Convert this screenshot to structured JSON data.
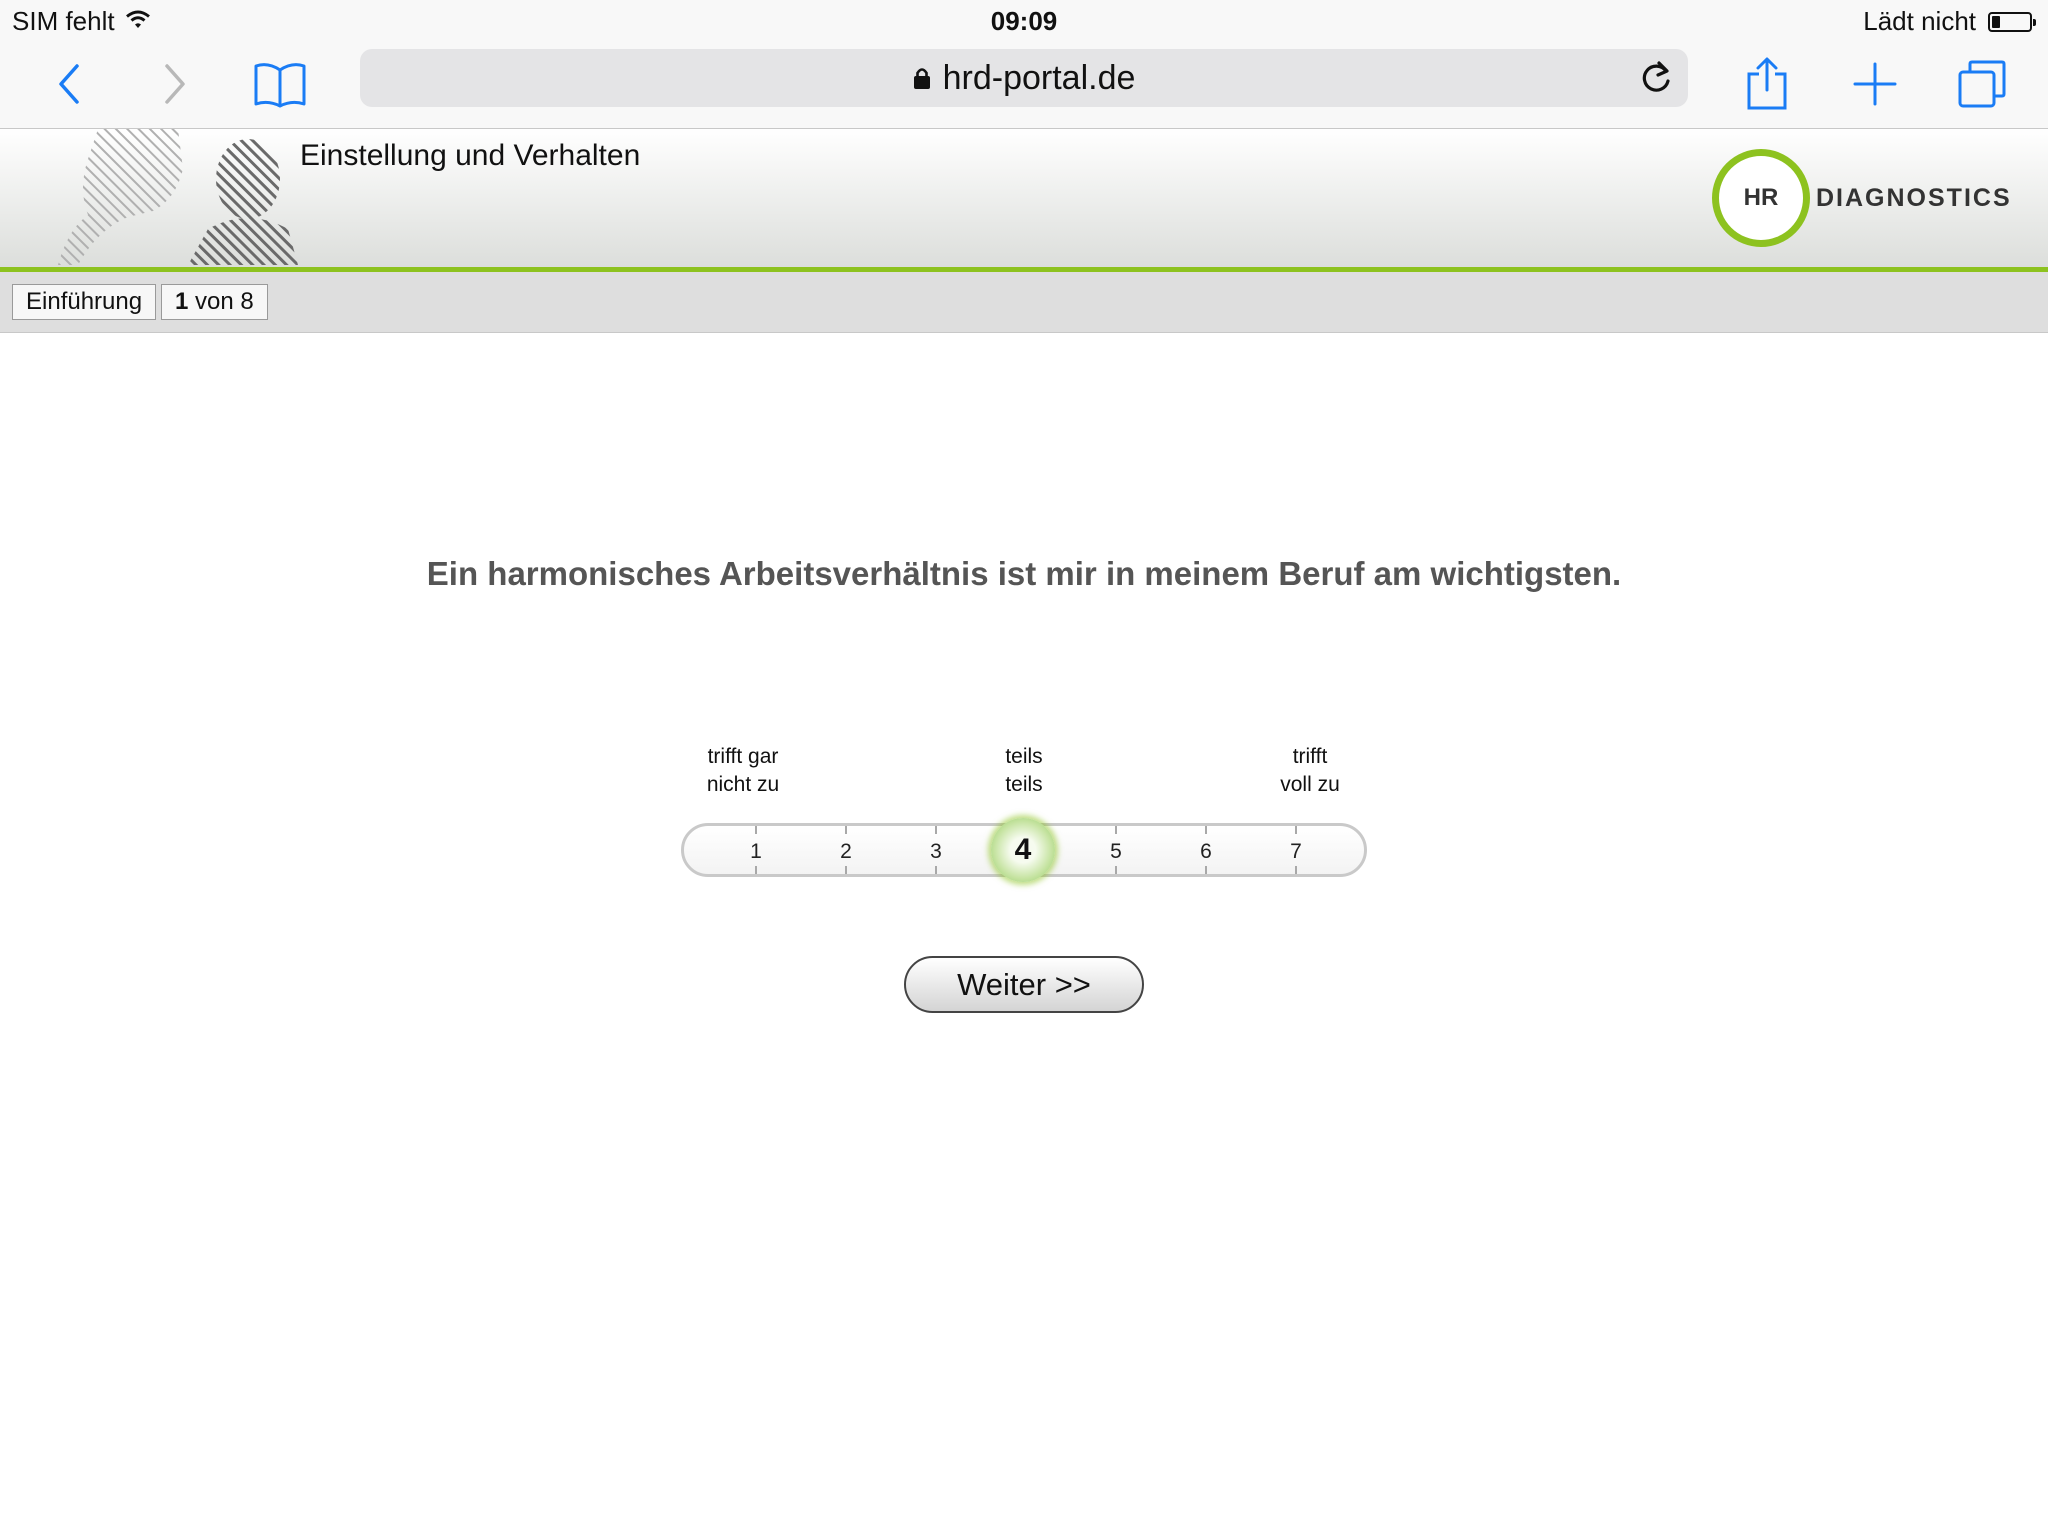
{
  "status_bar": {
    "carrier": "SIM fehlt",
    "time": "09:09",
    "battery_text": "Lädt nicht"
  },
  "browser": {
    "url": "hrd-portal.de",
    "icons": [
      "back-chevron-icon",
      "forward-chevron-icon",
      "bookmarks-book-icon",
      "lock-icon",
      "reload-icon",
      "share-icon",
      "new-tab-plus-icon",
      "tabs-icon"
    ],
    "accent_color": "#1a7cf5"
  },
  "header": {
    "test_title": "Einstellung und Verhalten",
    "logo": {
      "mark": "HR",
      "word": "DIAGNOSTICS",
      "color": "#8dc21f"
    }
  },
  "progress": {
    "section_label": "Einführung",
    "current": "1",
    "of_text": "von 8"
  },
  "question": {
    "text": "Ein harmonisches Arbeitsverhältnis ist mir in meinem Beruf am wichtigsten."
  },
  "scale": {
    "anchor_low": {
      "line1": "trifft gar",
      "line2": "nicht zu"
    },
    "anchor_mid": {
      "line1": "teils",
      "line2": "teils"
    },
    "anchor_high": {
      "line1": "trifft",
      "line2": "voll zu"
    },
    "steps": [
      "1",
      "2",
      "3",
      "4",
      "5",
      "6",
      "7"
    ],
    "selected": "4",
    "selected_color": "#8dc21f"
  },
  "actions": {
    "next_label": "Weiter >>"
  }
}
